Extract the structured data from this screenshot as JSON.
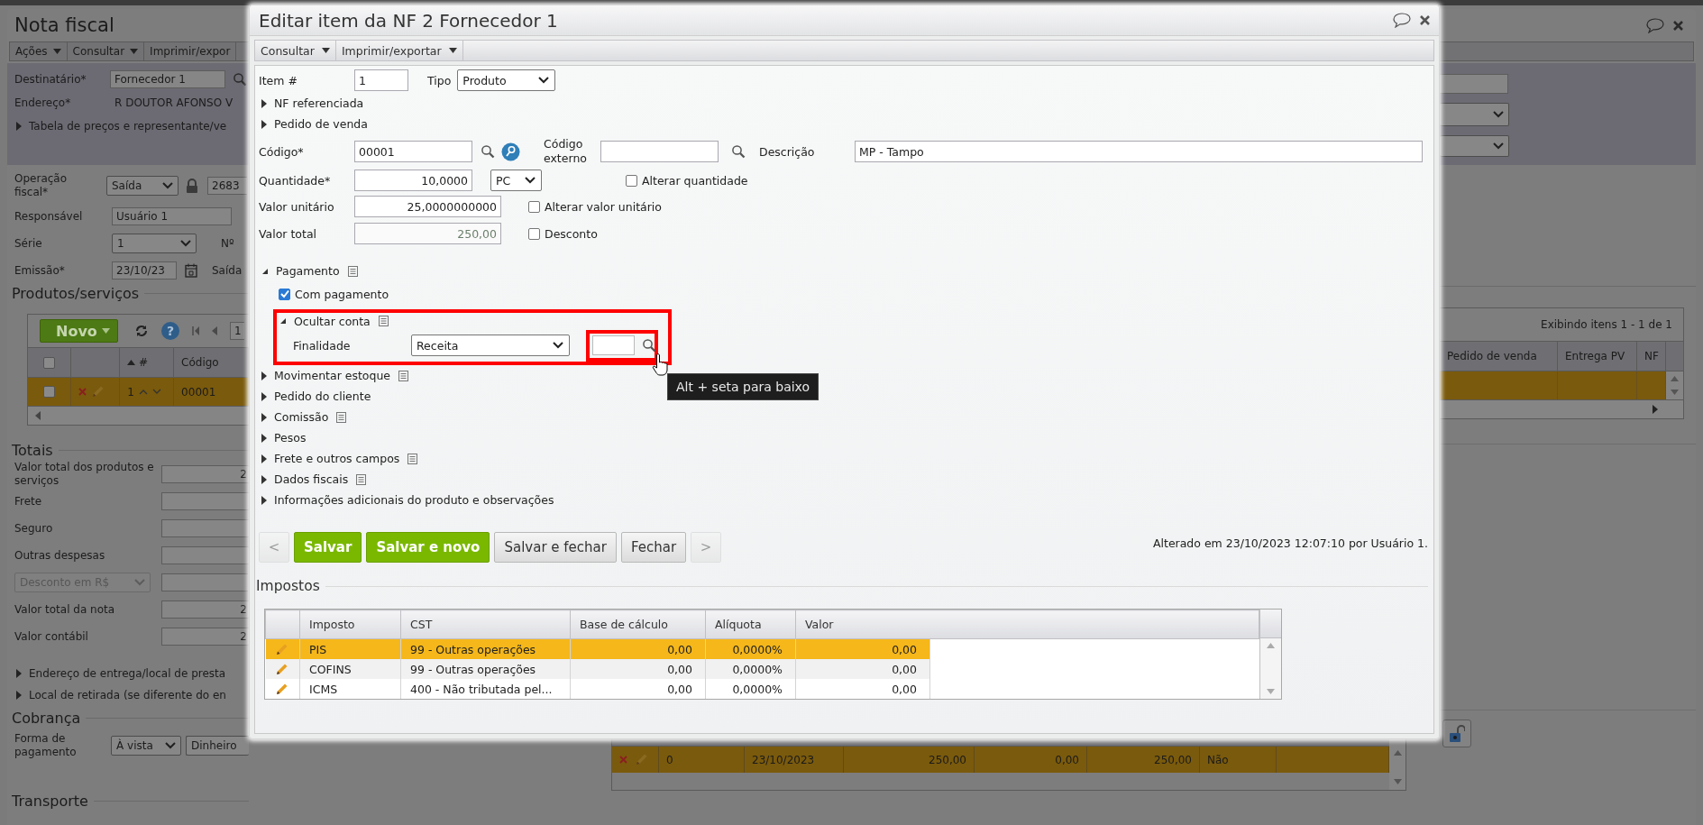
{
  "main_window": {
    "title": "Nota fiscal",
    "menu": [
      {
        "label": "Ações",
        "caret": true
      },
      {
        "label": "Consultar",
        "caret": true
      },
      {
        "label": "Imprimir/expor",
        "caret": false
      }
    ],
    "destinatario": {
      "label": "Destinatário*",
      "value": "Fornecedor 1"
    },
    "endereco": {
      "label": "Endereço*",
      "value": "R DOUTOR AFONSO V"
    },
    "tabela": {
      "label": "Tabela de preços e representante/ve",
      "expanded": false
    },
    "fields": [
      {
        "kind": "operation",
        "label": "Operação fiscal*",
        "value": "Saída",
        "code": "2683"
      },
      {
        "kind": "lookup",
        "label": "Responsável",
        "value": "Usuário 1"
      },
      {
        "kind": "select",
        "label": "Série",
        "value": "1",
        "next_label": "Nº"
      },
      {
        "kind": "date",
        "label": "Emissão*",
        "value": "23/10/23",
        "next_label": "Saída"
      }
    ],
    "products": {
      "title": "Produtos/serviços",
      "new_button": "Novo",
      "help": "?",
      "page": "1",
      "status": "Exibindo itens 1 - 1 de 1",
      "select_all": false,
      "columns": [
        {
          "label": "#",
          "sorted": true
        },
        {
          "label": "Código",
          "sorted": false
        },
        {
          "label": "Pedido de venda",
          "sorted": false
        },
        {
          "label": "Entrega PV",
          "sorted": false
        },
        {
          "label": "NF",
          "sorted": false
        }
      ],
      "rows": [
        {
          "number": "1",
          "code": "00001",
          "checked": false,
          "selected": true
        }
      ]
    },
    "totals": {
      "title": "Totais",
      "rows": [
        {
          "kind": "field",
          "label": "Valor total dos produtos e serviços",
          "value": "2",
          "disabled": false
        },
        {
          "kind": "field",
          "label": "Frete",
          "disabled": false
        },
        {
          "kind": "field",
          "label": "Seguro",
          "disabled": false
        },
        {
          "kind": "field",
          "label": "Outras despesas",
          "disabled": false
        },
        {
          "kind": "select",
          "label": "Desconto em R$",
          "disabled": true
        },
        {
          "kind": "field",
          "label": "Valor total da nota",
          "value": "2",
          "disabled": false
        },
        {
          "kind": "field",
          "label": "Valor contábil",
          "value": "2",
          "disabled": false
        }
      ]
    },
    "sections": [
      {
        "label": "Endereço de entrega/local de presta",
        "expanded": false
      },
      {
        "label": "Local de retirada (se diferente do en",
        "expanded": false
      }
    ],
    "cobranca": {
      "title": "Cobrança",
      "label": "Forma de pagamento",
      "condition": "À vista",
      "method": "Dinheiro",
      "rows": [
        {
          "cells": [
            "0",
            "23/10/2023",
            "250,00",
            "0,00",
            "250,00",
            "Não"
          ],
          "selected": true
        }
      ]
    },
    "transporte": {
      "title": "Transporte"
    }
  },
  "dialog": {
    "title": "Editar item da NF 2 Fornecedor 1",
    "menu": [
      {
        "label": "Consultar",
        "caret": true
      },
      {
        "label": "Imprimir/exportar",
        "caret": true
      }
    ],
    "item": {
      "label": "Item #",
      "value": "1"
    },
    "tipo": {
      "label": "Tipo",
      "value": "Produto"
    },
    "top_sections": [
      {
        "label": "NF referenciada",
        "expanded": false
      },
      {
        "label": "Pedido de venda",
        "expanded": false
      }
    ],
    "codigo": {
      "label": "Código*",
      "value": "00001"
    },
    "codigo_externo": {
      "label": "Código externo"
    },
    "descricao": {
      "label": "Descrição",
      "value": "MP - Tampo"
    },
    "quantidade": {
      "label": "Quantidade*",
      "value": "10,0000",
      "unit": "PC"
    },
    "alterar_quantidade": {
      "label": "Alterar quantidade",
      "checked": false
    },
    "valor_unitario": {
      "label": "Valor unitário",
      "value": "25,0000000000"
    },
    "alterar_valor": {
      "label": "Alterar valor unitário",
      "checked": false
    },
    "valor_total": {
      "label": "Valor total",
      "value": "250,00",
      "readonly": true
    },
    "desconto": {
      "label": "Desconto",
      "checked": false
    },
    "pagamento": {
      "label": "Pagamento",
      "expanded": true,
      "notes": true,
      "com_pagamento": {
        "label": "Com pagamento",
        "checked": true
      },
      "ocultar_conta": {
        "label": "Ocultar conta",
        "expanded": true,
        "notes": true
      },
      "finalidade": {
        "label": "Finalidade",
        "value": "Receita"
      }
    },
    "tooltip": "Alt + seta para baixo",
    "sections": [
      {
        "label": "Movimentar estoque",
        "expanded": false,
        "notes": true
      },
      {
        "label": "Pedido do cliente",
        "expanded": false,
        "notes": false
      },
      {
        "label": "Comissão",
        "expanded": false,
        "notes": true
      },
      {
        "label": "Pesos",
        "expanded": false,
        "notes": false
      },
      {
        "label": "Frete e outros campos",
        "expanded": false,
        "notes": true
      },
      {
        "label": "Dados fiscais",
        "expanded": false,
        "notes": true
      },
      {
        "label": "Informações adicionais do produto e observações",
        "expanded": false,
        "notes": false
      }
    ],
    "buttons": [
      {
        "label": "<",
        "kind": "nav",
        "disabled": true
      },
      {
        "label": "Salvar",
        "kind": "primary",
        "disabled": false
      },
      {
        "label": "Salvar e novo",
        "kind": "primary",
        "disabled": false
      },
      {
        "label": "Salvar e fechar",
        "kind": "secondary",
        "disabled": false
      },
      {
        "label": "Fechar",
        "kind": "secondary",
        "disabled": false
      },
      {
        "label": ">",
        "kind": "nav",
        "disabled": true
      }
    ],
    "modified": "Alterado em 23/10/2023 12:07:10 por Usuário 1.",
    "taxes": {
      "title": "Impostos",
      "columns": [
        "Imposto",
        "CST",
        "Base de cálculo",
        "Alíquota",
        "Valor"
      ],
      "rows": [
        {
          "imposto": "PIS",
          "cst": "99 - Outras operações",
          "base": "0,00",
          "aliquota": "0,0000%",
          "valor": "0,00",
          "selected": true
        },
        {
          "imposto": "COFINS",
          "cst": "99 - Outras operações",
          "base": "0,00",
          "aliquota": "0,0000%",
          "valor": "0,00",
          "selected": false
        },
        {
          "imposto": "ICMS",
          "cst": "400 - Não tributada pel...",
          "base": "0,00",
          "aliquota": "0,0000%",
          "valor": "0,00",
          "selected": false
        }
      ]
    }
  }
}
